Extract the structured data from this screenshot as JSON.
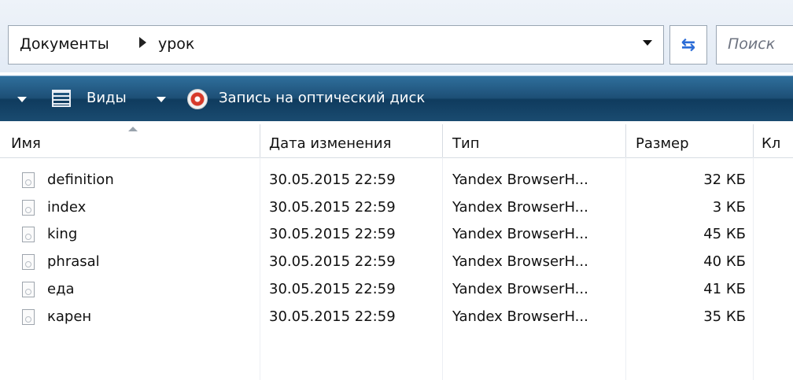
{
  "address": {
    "breadcrumb": [
      "Документы",
      "урок"
    ],
    "search_placeholder": "Поиск",
    "icons": [
      "dropdown-arrow-icon",
      "refresh-icon",
      "breadcrumb-separator-icon"
    ]
  },
  "toolbar": {
    "views_label": "Виды",
    "burn_label": "Запись на оптический диск",
    "icons": [
      "menu-arrow-icon",
      "views-icon",
      "views-arrow-icon",
      "burn-disc-icon"
    ],
    "colors": {
      "bar_top": "#2f6f9c",
      "bar_bottom": "#0f3b5e"
    }
  },
  "columns": [
    {
      "label": "Имя"
    },
    {
      "label": "Дата изменения"
    },
    {
      "label": "Тип"
    },
    {
      "label": "Размер"
    },
    {
      "label": "Кл"
    }
  ],
  "files": [
    {
      "name": "definition",
      "date": "30.05.2015 22:59",
      "type": "Yandex BrowserH...",
      "size": "32 КБ"
    },
    {
      "name": "index",
      "date": "30.05.2015 22:59",
      "type": "Yandex BrowserH...",
      "size": "3 КБ"
    },
    {
      "name": "king",
      "date": "30.05.2015 22:59",
      "type": "Yandex BrowserH...",
      "size": "45 КБ"
    },
    {
      "name": "phrasal",
      "date": "30.05.2015 22:59",
      "type": "Yandex BrowserH...",
      "size": "40 КБ"
    },
    {
      "name": "еда",
      "date": "30.05.2015 22:59",
      "type": "Yandex BrowserH...",
      "size": "41 КБ"
    },
    {
      "name": "карен",
      "date": "30.05.2015 22:59",
      "type": "Yandex BrowserH...",
      "size": "35 КБ"
    }
  ]
}
